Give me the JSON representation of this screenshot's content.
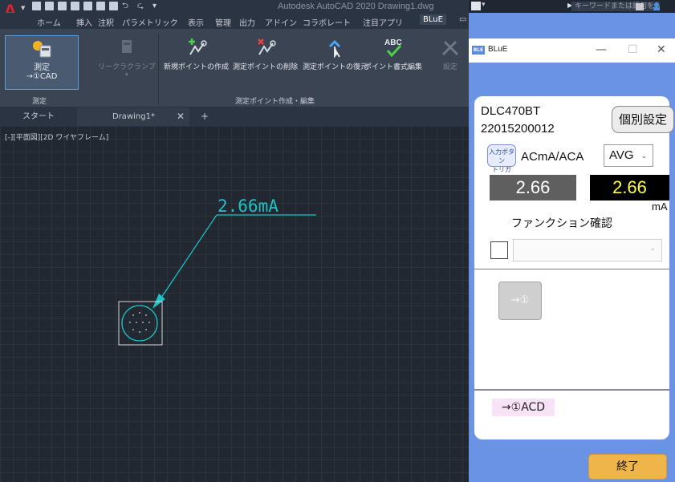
{
  "acad": {
    "title": "Autodesk AutoCAD 2020    Drawing1.dwg",
    "ribbon_tabs": [
      "ホーム",
      "挿入",
      "注釈",
      "パラメトリック",
      "表示",
      "管理",
      "出力",
      "アドイン",
      "コラボレート",
      "注目アプリ",
      "BLuE"
    ],
    "active_tab": "BLuE",
    "ribbon": {
      "measure_label": "測定",
      "measure_sub": "→①CAD",
      "leak_clamp": "リークラクランプ",
      "new_point": "新規ポイントの作成",
      "delete_point": "測定ポイントの削除",
      "restore_point": "測定ポイントの復元",
      "point_format": "ポイント書式編集",
      "settings": "設定",
      "panel_measure": "測定",
      "panel_points": "測定ポイント作成・編集"
    },
    "doc_tabs": [
      "スタート",
      "Drawing1*"
    ],
    "viewport_label": "[-][平面図][2D ワイヤフレーム]",
    "annotation_text": "2.66mA",
    "accent_cyan": "#1fc2c8",
    "logo_color": "#e0202a"
  },
  "topbar": {
    "search_placeholder": "キーワードまたは語句を入力"
  },
  "blue": {
    "title": "BLuE",
    "icon_text": "BLE",
    "device_model": "DLC470BT",
    "device_serial": "22015200012",
    "individual_settings": "個別設定",
    "trigger_button": "入力ボタン\nトリガ",
    "mode_label": "ACmA/ACA",
    "avg_value": "AVG",
    "value_left": "2.66",
    "value_right": "2.66",
    "unit": "mA",
    "function_label": "ファンクション確認",
    "point_button": "→①",
    "acd_tag": "→①ACD",
    "end_button": "終了",
    "bg_color": "#6a93e6",
    "value_color": "#ffff3a",
    "end_color": "#f0b54a"
  }
}
